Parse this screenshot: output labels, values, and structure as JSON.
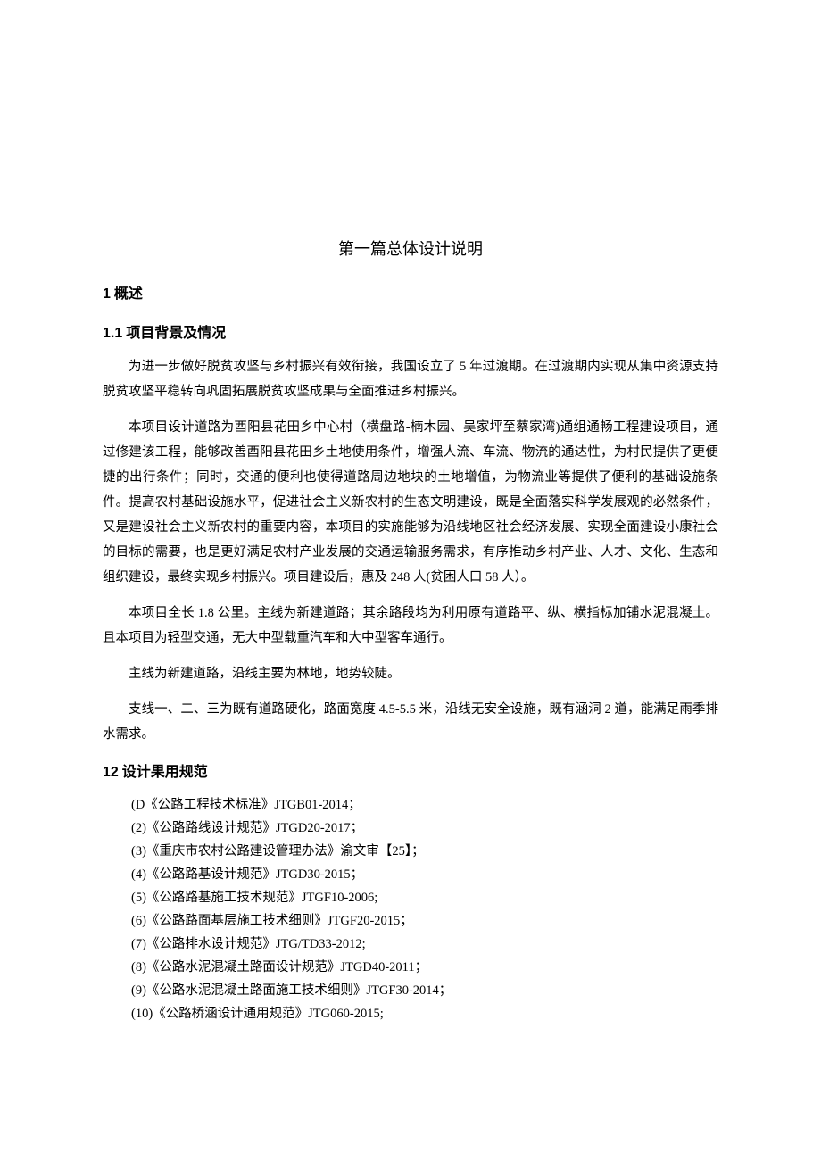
{
  "title": "第一篇总体设计说明",
  "section1": {
    "num": "1",
    "heading": "概述"
  },
  "section1_1": {
    "num": "1.1",
    "heading": "项目背景及情况",
    "p1": "为进一步做好脱贫攻坚与乡村振兴有效衔接，我国设立了 5 年过渡期。在过渡期内实现从集中资源支持脱贫攻坚平稳转向巩固拓展脱贫攻坚成果与全面推进乡村振兴。",
    "p2": "本项目设计道路为酉阳县花田乡中心村（横盘路-楠木园、吴家坪至蔡家湾)通组通畅工程建设项目，通过修建该工程，能够改善酉阳县花田乡土地使用条件，增强人流、车流、物流的通达性，为村民提供了更便捷的出行条件；同时，交通的便利也使得道路周边地块的土地增值，为物流业等提供了便利的基础设施条件。提高农村基础设施水平，促进社会主义新农村的生态文明建设，既是全面落实科学发展观的必然条件，又是建设社会主义新农村的重要内容，本项目的实施能够为沿线地区社会经济发展、实现全面建设小康社会的目标的需要，也是更好满足农村产业发展的交通运输服务需求，有序推动乡村产业、人才、文化、生态和组织建设，最终实现乡村振兴。项目建设后，惠及 248 人(贫困人口 58 人）。",
    "p3": "本项目全长 1.8 公里。主线为新建道路；其余路段均为利用原有道路平、纵、横指标加铺水泥混凝土。且本项目为轻型交通，无大中型载重汽车和大中型客车通行。",
    "p4": "主线为新建道路，沿线主要为林地，地势较陡。",
    "p5": "支线一、二、三为既有道路硬化，路面宽度 4.5-5.5 米，沿线无安全设施，既有涵洞 2 道，能满足雨季排水需求。"
  },
  "section1_2": {
    "num": "12",
    "heading": "设计果用规范",
    "items": [
      "(D《公路工程技术标准》JTGB01-2014；",
      "(2)《公路路线设计规范》JTGD20-2017；",
      "(3)《重庆市农村公路建设管理办法》渝文审【25】；",
      "(4)《公路路基设计规范》JTGD30-2015；",
      "(5)《公路路基施工技术规范》JTGF10-2006;",
      "(6)《公路路面基层施工技术细则》JTGF20-2015；",
      "(7)《公路排水设计规范》JTG/TD33-2012;",
      "(8)《公路水泥混凝土路面设计规范》JTGD40-2011；",
      "(9)《公路水泥混凝土路面施工技术细则》JTGF30-2014；",
      "(10)《公路桥涵设计通用规范》JTG060-2015;"
    ]
  }
}
